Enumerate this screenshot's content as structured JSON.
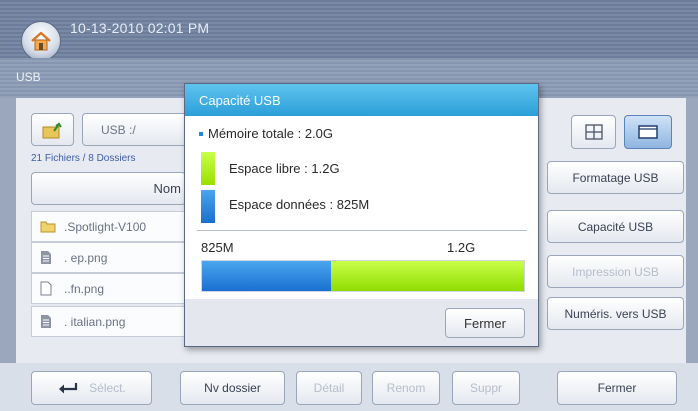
{
  "status": {
    "datetime": "10-13-2010 02:01 PM"
  },
  "title": "USB",
  "browser": {
    "drive": "USB :/",
    "counts": "21 Fichiers / 8 Dossiers",
    "column_header": "Nom",
    "files": [
      {
        "name": ".Spotlight-V100",
        "icon": "folder-icon"
      },
      {
        "name": ". ep.png",
        "icon": "document-icon"
      },
      {
        "name": "..fn.png",
        "icon": "document-outline-icon"
      },
      {
        "name": ". italian.png",
        "icon": "document-icon"
      }
    ]
  },
  "side_buttons": [
    "Formatage USB",
    "Capacité USB",
    "Impression USB",
    "Numéris. vers USB"
  ],
  "bottom": {
    "select": "Sélect.",
    "new_folder": "Nv dossier",
    "detail": "Détail",
    "rename": "Renom",
    "delete": "Suppr",
    "close": "Fermer"
  },
  "dialog": {
    "title": "Capacité USB",
    "total_memory": "Mémoire totale : 2.0G",
    "free_space": "Espace libre : 1.2G",
    "data_space": "Espace données : 825M",
    "bar_used_label": "825M",
    "bar_free_label": "1.2G",
    "used_fraction": 0.4,
    "close": "Fermer"
  },
  "colors": {
    "used": "#1a6fd0",
    "free": "#9be000",
    "header": "#2b9fd8"
  }
}
